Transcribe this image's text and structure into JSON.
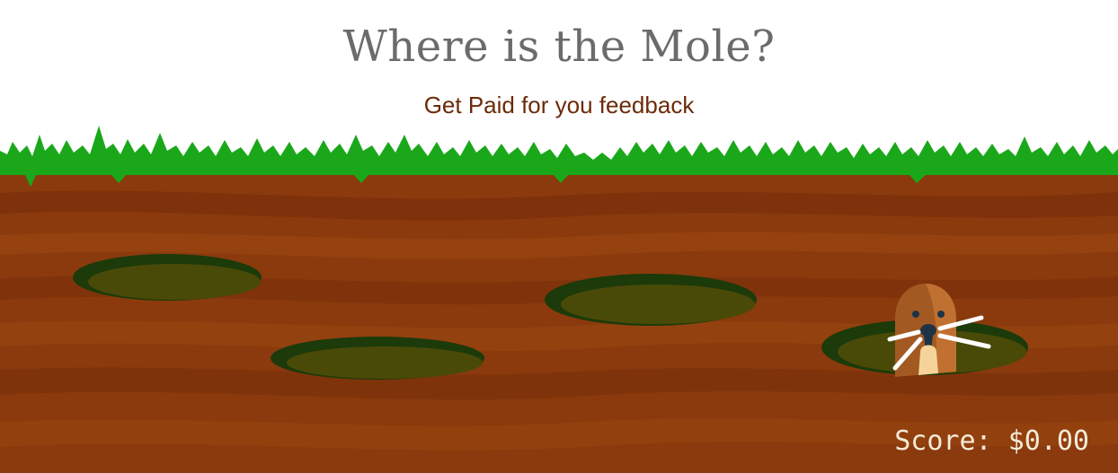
{
  "game": {
    "title": "Where is the Mole?",
    "subtitle": "Get Paid for you feedback",
    "score_label": "Score:",
    "score_value": "$0.00"
  },
  "colors": {
    "title": "#6b6b6b",
    "subtitle": "#6b2a08",
    "grass": "#1aa81a",
    "soil": "#8a3a0c",
    "hole_rim": "#1c3a0a",
    "hole_floor": "#4a4a08",
    "mole_fur": "#a35a22",
    "score": "#f4ead8"
  },
  "icons": {
    "mole": "mole-icon"
  }
}
